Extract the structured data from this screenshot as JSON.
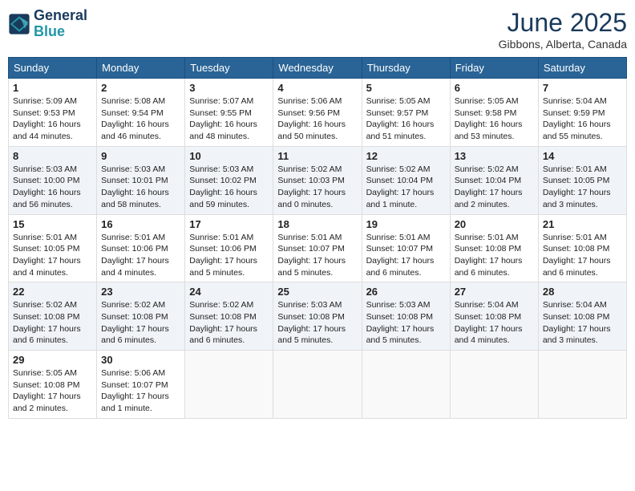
{
  "header": {
    "logo_line1": "General",
    "logo_line2": "Blue",
    "month": "June 2025",
    "location": "Gibbons, Alberta, Canada"
  },
  "weekdays": [
    "Sunday",
    "Monday",
    "Tuesday",
    "Wednesday",
    "Thursday",
    "Friday",
    "Saturday"
  ],
  "weeks": [
    [
      {
        "day": 1,
        "sunrise": "5:09 AM",
        "sunset": "9:53 PM",
        "daylight": "16 hours and 44 minutes."
      },
      {
        "day": 2,
        "sunrise": "5:08 AM",
        "sunset": "9:54 PM",
        "daylight": "16 hours and 46 minutes."
      },
      {
        "day": 3,
        "sunrise": "5:07 AM",
        "sunset": "9:55 PM",
        "daylight": "16 hours and 48 minutes."
      },
      {
        "day": 4,
        "sunrise": "5:06 AM",
        "sunset": "9:56 PM",
        "daylight": "16 hours and 50 minutes."
      },
      {
        "day": 5,
        "sunrise": "5:05 AM",
        "sunset": "9:57 PM",
        "daylight": "16 hours and 51 minutes."
      },
      {
        "day": 6,
        "sunrise": "5:05 AM",
        "sunset": "9:58 PM",
        "daylight": "16 hours and 53 minutes."
      },
      {
        "day": 7,
        "sunrise": "5:04 AM",
        "sunset": "9:59 PM",
        "daylight": "16 hours and 55 minutes."
      }
    ],
    [
      {
        "day": 8,
        "sunrise": "5:03 AM",
        "sunset": "10:00 PM",
        "daylight": "16 hours and 56 minutes."
      },
      {
        "day": 9,
        "sunrise": "5:03 AM",
        "sunset": "10:01 PM",
        "daylight": "16 hours and 58 minutes."
      },
      {
        "day": 10,
        "sunrise": "5:03 AM",
        "sunset": "10:02 PM",
        "daylight": "16 hours and 59 minutes."
      },
      {
        "day": 11,
        "sunrise": "5:02 AM",
        "sunset": "10:03 PM",
        "daylight": "17 hours and 0 minutes."
      },
      {
        "day": 12,
        "sunrise": "5:02 AM",
        "sunset": "10:04 PM",
        "daylight": "17 hours and 1 minute."
      },
      {
        "day": 13,
        "sunrise": "5:02 AM",
        "sunset": "10:04 PM",
        "daylight": "17 hours and 2 minutes."
      },
      {
        "day": 14,
        "sunrise": "5:01 AM",
        "sunset": "10:05 PM",
        "daylight": "17 hours and 3 minutes."
      }
    ],
    [
      {
        "day": 15,
        "sunrise": "5:01 AM",
        "sunset": "10:05 PM",
        "daylight": "17 hours and 4 minutes."
      },
      {
        "day": 16,
        "sunrise": "5:01 AM",
        "sunset": "10:06 PM",
        "daylight": "17 hours and 4 minutes."
      },
      {
        "day": 17,
        "sunrise": "5:01 AM",
        "sunset": "10:06 PM",
        "daylight": "17 hours and 5 minutes."
      },
      {
        "day": 18,
        "sunrise": "5:01 AM",
        "sunset": "10:07 PM",
        "daylight": "17 hours and 5 minutes."
      },
      {
        "day": 19,
        "sunrise": "5:01 AM",
        "sunset": "10:07 PM",
        "daylight": "17 hours and 6 minutes."
      },
      {
        "day": 20,
        "sunrise": "5:01 AM",
        "sunset": "10:08 PM",
        "daylight": "17 hours and 6 minutes."
      },
      {
        "day": 21,
        "sunrise": "5:01 AM",
        "sunset": "10:08 PM",
        "daylight": "17 hours and 6 minutes."
      }
    ],
    [
      {
        "day": 22,
        "sunrise": "5:02 AM",
        "sunset": "10:08 PM",
        "daylight": "17 hours and 6 minutes."
      },
      {
        "day": 23,
        "sunrise": "5:02 AM",
        "sunset": "10:08 PM",
        "daylight": "17 hours and 6 minutes."
      },
      {
        "day": 24,
        "sunrise": "5:02 AM",
        "sunset": "10:08 PM",
        "daylight": "17 hours and 6 minutes."
      },
      {
        "day": 25,
        "sunrise": "5:03 AM",
        "sunset": "10:08 PM",
        "daylight": "17 hours and 5 minutes."
      },
      {
        "day": 26,
        "sunrise": "5:03 AM",
        "sunset": "10:08 PM",
        "daylight": "17 hours and 5 minutes."
      },
      {
        "day": 27,
        "sunrise": "5:04 AM",
        "sunset": "10:08 PM",
        "daylight": "17 hours and 4 minutes."
      },
      {
        "day": 28,
        "sunrise": "5:04 AM",
        "sunset": "10:08 PM",
        "daylight": "17 hours and 3 minutes."
      }
    ],
    [
      {
        "day": 29,
        "sunrise": "5:05 AM",
        "sunset": "10:08 PM",
        "daylight": "17 hours and 2 minutes."
      },
      {
        "day": 30,
        "sunrise": "5:06 AM",
        "sunset": "10:07 PM",
        "daylight": "17 hours and 1 minute."
      },
      null,
      null,
      null,
      null,
      null
    ]
  ],
  "labels": {
    "sunrise": "Sunrise:",
    "sunset": "Sunset:",
    "daylight": "Daylight:"
  }
}
